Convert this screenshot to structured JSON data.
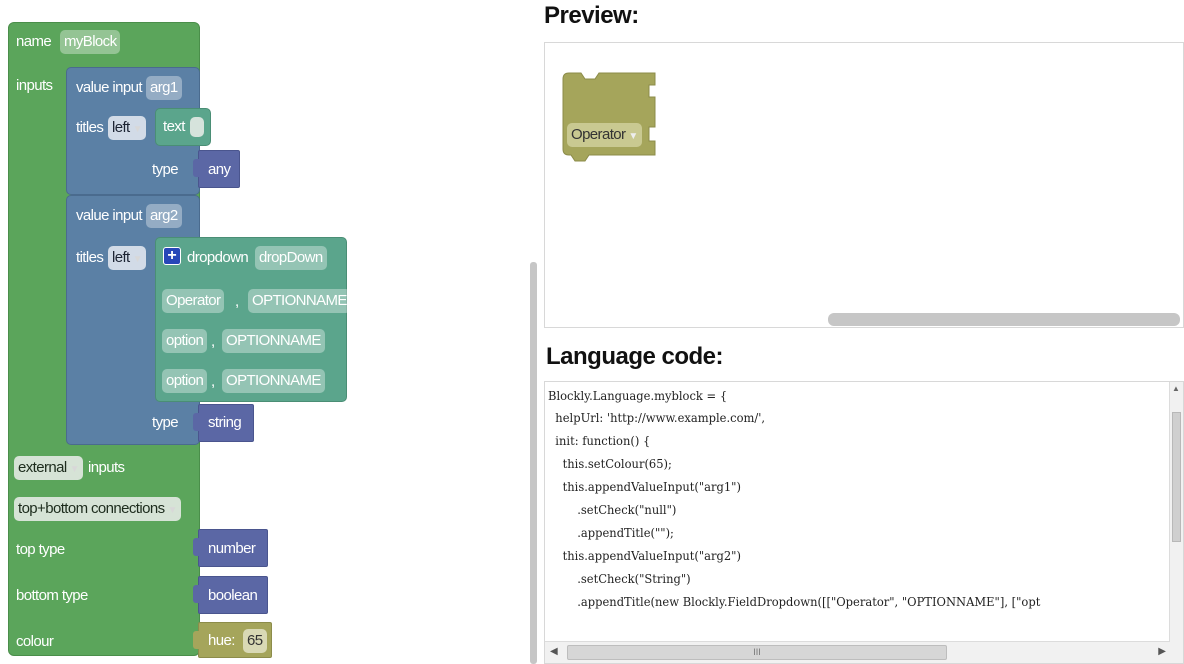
{
  "workspace": {
    "factory_block": {
      "name_label": "name",
      "name_value": "myBlock",
      "inputs_label": "inputs",
      "external_label": "external",
      "inputs_suffix": "inputs",
      "connections_label": "top+bottom connections",
      "top_type_label": "top type",
      "top_type_value": "number",
      "bottom_type_label": "bottom type",
      "bottom_type_value": "boolean",
      "colour_label": "colour",
      "hue_label": "hue:",
      "hue_value": "65"
    },
    "input1": {
      "label": "value input",
      "name": "arg1",
      "titles_label": "titles",
      "align": "left",
      "text_label": "text",
      "text_value": "",
      "type_label": "type",
      "type_value": "any"
    },
    "input2": {
      "label": "value input",
      "name": "arg2",
      "titles_label": "titles",
      "align": "left",
      "dropdown_label": "dropdown",
      "dropdown_name": "dropDown",
      "options": [
        {
          "text": "Operator",
          "sep": ",",
          "value": "OPTIONNAME"
        },
        {
          "text": "option",
          "sep": ",",
          "value": "OPTIONNAME"
        },
        {
          "text": "option",
          "sep": ",",
          "value": "OPTIONNAME"
        }
      ],
      "type_label": "type",
      "type_value": "string"
    }
  },
  "preview": {
    "heading": "Preview:",
    "block_label": "Operator"
  },
  "language": {
    "heading": "Language code:",
    "lines": [
      "Blockly.Language.myblock = {",
      "  helpUrl: 'http://www.example.com/',",
      "  init: function() {",
      "    this.setColour(65);",
      "    this.appendValueInput(\"arg1\")",
      "        .setCheck(\"null\")",
      "        .appendTitle(\"\");",
      "    this.appendValueInput(\"arg2\")",
      "        .setCheck(\"String\")",
      "        .appendTitle(new Blockly.FieldDropdown([[\"Operator\", \"OPTIONNAME\"], [\"opt"
    ],
    "scroll_grip": "III"
  },
  "colors": {
    "factory_green": "#5ba55b",
    "input_blue": "#5b80a5",
    "dropdown_teal": "#5ba58c",
    "type_purple": "#5b67a5",
    "preview_olive": "#a5a55b"
  }
}
